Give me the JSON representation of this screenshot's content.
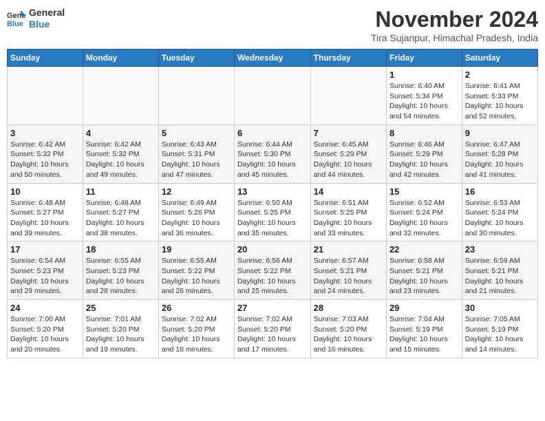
{
  "header": {
    "logo_line1": "General",
    "logo_line2": "Blue",
    "month_title": "November 2024",
    "location": "Tira Sujanpur, Himachal Pradesh, India"
  },
  "weekdays": [
    "Sunday",
    "Monday",
    "Tuesday",
    "Wednesday",
    "Thursday",
    "Friday",
    "Saturday"
  ],
  "weeks": [
    [
      {
        "day": "",
        "info": ""
      },
      {
        "day": "",
        "info": ""
      },
      {
        "day": "",
        "info": ""
      },
      {
        "day": "",
        "info": ""
      },
      {
        "day": "",
        "info": ""
      },
      {
        "day": "1",
        "info": "Sunrise: 6:40 AM\nSunset: 5:34 PM\nDaylight: 10 hours and 54 minutes."
      },
      {
        "day": "2",
        "info": "Sunrise: 6:41 AM\nSunset: 5:33 PM\nDaylight: 10 hours and 52 minutes."
      }
    ],
    [
      {
        "day": "3",
        "info": "Sunrise: 6:42 AM\nSunset: 5:32 PM\nDaylight: 10 hours and 50 minutes."
      },
      {
        "day": "4",
        "info": "Sunrise: 6:42 AM\nSunset: 5:32 PM\nDaylight: 10 hours and 49 minutes."
      },
      {
        "day": "5",
        "info": "Sunrise: 6:43 AM\nSunset: 5:31 PM\nDaylight: 10 hours and 47 minutes."
      },
      {
        "day": "6",
        "info": "Sunrise: 6:44 AM\nSunset: 5:30 PM\nDaylight: 10 hours and 45 minutes."
      },
      {
        "day": "7",
        "info": "Sunrise: 6:45 AM\nSunset: 5:29 PM\nDaylight: 10 hours and 44 minutes."
      },
      {
        "day": "8",
        "info": "Sunrise: 6:46 AM\nSunset: 5:29 PM\nDaylight: 10 hours and 42 minutes."
      },
      {
        "day": "9",
        "info": "Sunrise: 6:47 AM\nSunset: 5:28 PM\nDaylight: 10 hours and 41 minutes."
      }
    ],
    [
      {
        "day": "10",
        "info": "Sunrise: 6:48 AM\nSunset: 5:27 PM\nDaylight: 10 hours and 39 minutes."
      },
      {
        "day": "11",
        "info": "Sunrise: 6:48 AM\nSunset: 5:27 PM\nDaylight: 10 hours and 38 minutes."
      },
      {
        "day": "12",
        "info": "Sunrise: 6:49 AM\nSunset: 5:26 PM\nDaylight: 10 hours and 36 minutes."
      },
      {
        "day": "13",
        "info": "Sunrise: 6:50 AM\nSunset: 5:25 PM\nDaylight: 10 hours and 35 minutes."
      },
      {
        "day": "14",
        "info": "Sunrise: 6:51 AM\nSunset: 5:25 PM\nDaylight: 10 hours and 33 minutes."
      },
      {
        "day": "15",
        "info": "Sunrise: 6:52 AM\nSunset: 5:24 PM\nDaylight: 10 hours and 32 minutes."
      },
      {
        "day": "16",
        "info": "Sunrise: 6:53 AM\nSunset: 5:24 PM\nDaylight: 10 hours and 30 minutes."
      }
    ],
    [
      {
        "day": "17",
        "info": "Sunrise: 6:54 AM\nSunset: 5:23 PM\nDaylight: 10 hours and 29 minutes."
      },
      {
        "day": "18",
        "info": "Sunrise: 6:55 AM\nSunset: 5:23 PM\nDaylight: 10 hours and 28 minutes."
      },
      {
        "day": "19",
        "info": "Sunrise: 6:55 AM\nSunset: 5:22 PM\nDaylight: 10 hours and 26 minutes."
      },
      {
        "day": "20",
        "info": "Sunrise: 6:56 AM\nSunset: 5:22 PM\nDaylight: 10 hours and 25 minutes."
      },
      {
        "day": "21",
        "info": "Sunrise: 6:57 AM\nSunset: 5:21 PM\nDaylight: 10 hours and 24 minutes."
      },
      {
        "day": "22",
        "info": "Sunrise: 6:58 AM\nSunset: 5:21 PM\nDaylight: 10 hours and 23 minutes."
      },
      {
        "day": "23",
        "info": "Sunrise: 6:59 AM\nSunset: 5:21 PM\nDaylight: 10 hours and 21 minutes."
      }
    ],
    [
      {
        "day": "24",
        "info": "Sunrise: 7:00 AM\nSunset: 5:20 PM\nDaylight: 10 hours and 20 minutes."
      },
      {
        "day": "25",
        "info": "Sunrise: 7:01 AM\nSunset: 5:20 PM\nDaylight: 10 hours and 19 minutes."
      },
      {
        "day": "26",
        "info": "Sunrise: 7:02 AM\nSunset: 5:20 PM\nDaylight: 10 hours and 18 minutes."
      },
      {
        "day": "27",
        "info": "Sunrise: 7:02 AM\nSunset: 5:20 PM\nDaylight: 10 hours and 17 minutes."
      },
      {
        "day": "28",
        "info": "Sunrise: 7:03 AM\nSunset: 5:20 PM\nDaylight: 10 hours and 16 minutes."
      },
      {
        "day": "29",
        "info": "Sunrise: 7:04 AM\nSunset: 5:19 PM\nDaylight: 10 hours and 15 minutes."
      },
      {
        "day": "30",
        "info": "Sunrise: 7:05 AM\nSunset: 5:19 PM\nDaylight: 10 hours and 14 minutes."
      }
    ]
  ]
}
